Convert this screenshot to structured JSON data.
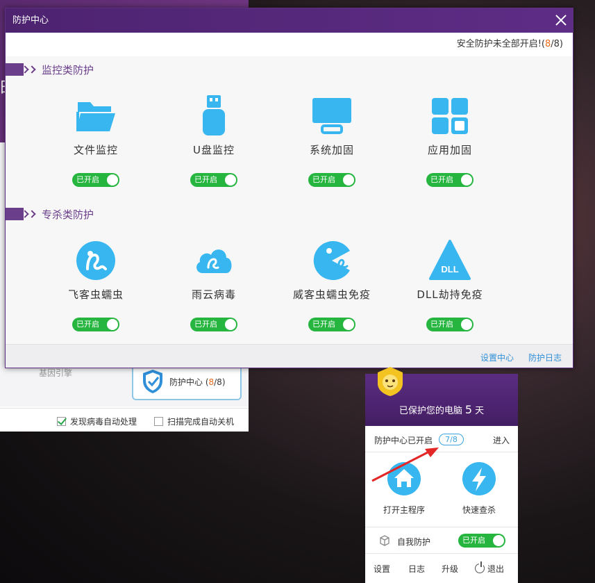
{
  "dialog": {
    "title": "防护中心",
    "status_prefix": "安全防护未全部开启!(",
    "status_on": "8",
    "status_suffix": "/8)",
    "sections": [
      {
        "title": "监控类防护",
        "items": [
          {
            "label": "文件监控",
            "icon": "folder-icon",
            "toggle": "已开启"
          },
          {
            "label": "U盘监控",
            "icon": "usb-drive-icon",
            "toggle": "已开启"
          },
          {
            "label": "系统加固",
            "icon": "monitor-icon",
            "toggle": "已开启"
          },
          {
            "label": "应用加固",
            "icon": "apps-grid-icon",
            "toggle": "已开启"
          }
        ]
      },
      {
        "title": "专杀类防护",
        "items": [
          {
            "label": "飞客虫蠕虫",
            "icon": "worm-icon",
            "toggle": "已开启"
          },
          {
            "label": "雨云病毒",
            "icon": "cloud-virus-icon",
            "toggle": "已开启"
          },
          {
            "label": "威客虫蠕虫免疫",
            "icon": "pacman-worm-icon",
            "toggle": "已开启"
          },
          {
            "label": "DLL劫持免疫",
            "icon": "dll-triangle-icon",
            "toggle": "已开启"
          }
        ]
      }
    ],
    "footer": {
      "settings_link": "设置中心",
      "log_link": "防护日志"
    },
    "accent_color": "#5e2d86",
    "icon_color": "#38b6f0",
    "toggle_color": "#26b53f"
  },
  "background_window": {
    "edge_glyph": "田",
    "engine_label": "基因引擎",
    "shield_card_prefix": "防护中心 (",
    "shield_card_on": "8",
    "shield_card_suffix": "/8)",
    "auto_handle_label": "发现病毒自动处理",
    "auto_shutdown_label": "扫描完成自动关机"
  },
  "mini_window": {
    "protected_prefix": "已保护您的电脑",
    "protected_days": "5",
    "protected_suffix": "天",
    "center_status": "防护中心已开启",
    "center_badge": "7/8",
    "enter_label": "进入",
    "open_main": "打开主程序",
    "quick_scan": "快速查杀",
    "self_protect": "自我防护",
    "self_toggle": "已开启",
    "bottom": {
      "settings": "设置",
      "log": "日志",
      "upgrade": "升级",
      "exit": "退出"
    }
  }
}
